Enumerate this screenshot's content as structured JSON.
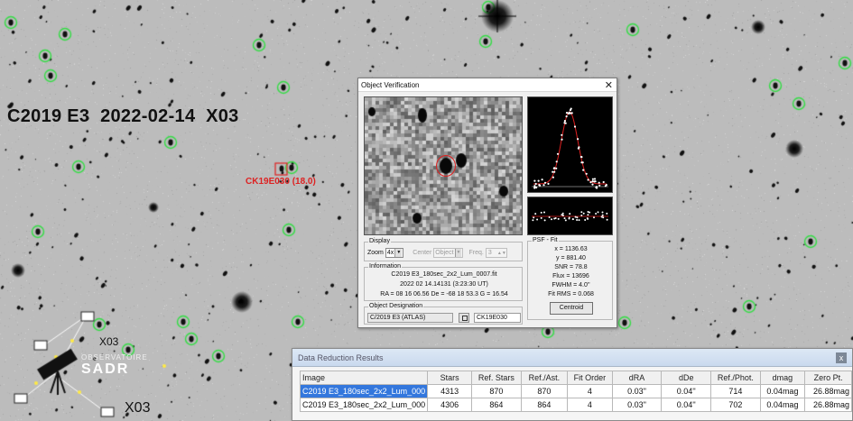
{
  "sky_image": {
    "title": "C2019 E3  2022-02-14  X03",
    "target_label": "CK19E030 (18.0)",
    "station_labels": [
      "X03",
      "X03"
    ],
    "observatory": {
      "line1": "OBSERVATOIRE",
      "line2": "SADR"
    },
    "marker_colors": {
      "reference_star": "#33dd44",
      "target": "#e02020"
    }
  },
  "object_verification": {
    "title": "Object Verification",
    "close_label": "✕",
    "display": {
      "group_label": "Display",
      "zoom_label": "Zoom",
      "zoom_value": "4x",
      "center_label": "Center",
      "center_value": "Object",
      "freq_label": "Freq.",
      "freq_value": "3"
    },
    "information": {
      "group_label": "Information",
      "filename": "C2019 E3_180sec_2x2_Lum_0007.fit",
      "date": "2022 02 14.14131 (3:23:30 UT)",
      "coords": "RA = 08 16 06.56   De = -68 18 53.3   G = 16.54"
    },
    "designation": {
      "group_label": "Object Designation",
      "name_value": "C/2019 E3 (ATLAS)",
      "id_value": "CK19E030"
    },
    "psf_fit": {
      "group_label": "PSF - Fit",
      "lines": [
        "x = 1136.63",
        "y = 881.40",
        "SNR = 78.8",
        "Flux = 13696",
        "FWHM = 4.0''",
        "Fit RMS = 0.068"
      ],
      "centroid_label": "Centroid"
    }
  },
  "data_reduction": {
    "title": "Data Reduction Results",
    "close_label": "x",
    "columns": [
      "Image",
      "Stars",
      "Ref. Stars",
      "Ref./Ast.",
      "Fit Order",
      "dRA",
      "dDe",
      "Ref./Phot.",
      "dmag",
      "Zero Pt."
    ],
    "rows": [
      [
        "C2019 E3_180sec_2x2_Lum_000",
        "4313",
        "870",
        "870",
        "4",
        "0.03''",
        "0.04''",
        "714",
        "0.04mag",
        "26.88mag"
      ],
      [
        "C2019 E3_180sec_2x2_Lum_000",
        "4306",
        "864",
        "864",
        "4",
        "0.03''",
        "0.04''",
        "702",
        "0.04mag",
        "26.88mag"
      ]
    ],
    "selected_row": 0
  }
}
